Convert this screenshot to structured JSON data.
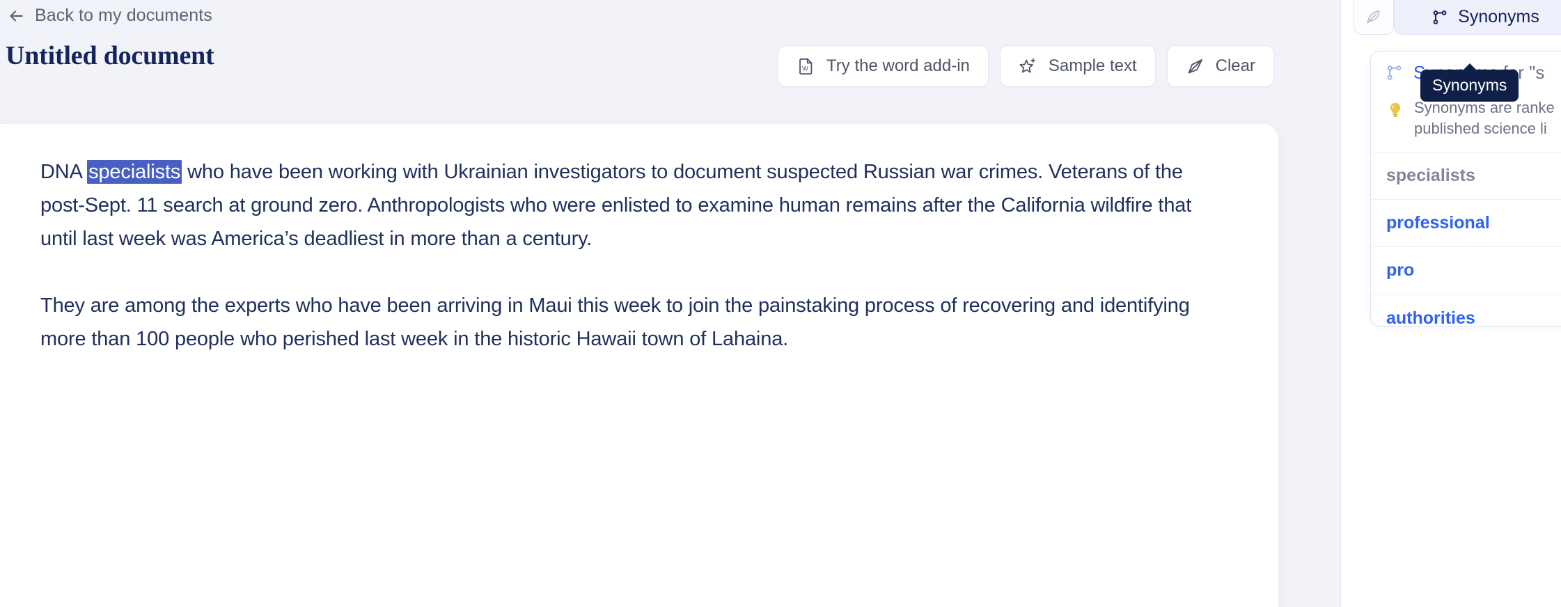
{
  "header": {
    "back_label": "Back to my documents",
    "back_icon": "arrow-left-icon",
    "document_title": "Untitled document"
  },
  "toolbar": {
    "buttons": [
      {
        "label": "Try the word add-in",
        "icon": "word-document-icon"
      },
      {
        "label": "Sample text",
        "icon": "sparkle-star-icon"
      },
      {
        "label": "Clear",
        "icon": "eraser-icon"
      }
    ]
  },
  "document": {
    "paragraph1": {
      "before": "DNA ",
      "highlight": "specialists",
      "after": " who have been working with Ukrainian investigators to document suspected Russian war crimes. Veterans of the post-Sept. 11 search at ground zero. Anthropologists who were enlisted to examine human remains after the California wildfire that until last week was America’s deadliest in more than a century."
    },
    "paragraph2": "They are among the experts who have been arriving in Maui this week to join the painstaking process of recovering and identifying more than 100 people who perished last week in the historic Hawaii town of Lahaina."
  },
  "right_panel": {
    "tabs": [
      {
        "label": "",
        "icon": "feather-pen-icon",
        "active": false
      },
      {
        "label": "Synonyms",
        "icon": "branch-synonyms-icon",
        "active": true
      }
    ],
    "tooltip": "Synonyms",
    "card": {
      "icon": "branch-synonyms-icon",
      "heading_strong": "Synonyms",
      "heading_muted": " for \"s",
      "tip_icon": "lightbulb-icon",
      "tip_line1": "Synonyms are ranke",
      "tip_line2": "published science li",
      "items": [
        {
          "label": "specialists",
          "state": "current"
        },
        {
          "label": "professional",
          "state": "alt"
        },
        {
          "label": "pro",
          "state": "alt"
        },
        {
          "label": "authorities",
          "state": "alt"
        }
      ]
    }
  },
  "colors": {
    "page_bg": "#f2f3f8",
    "accent_blue": "#2f63ef",
    "highlight_blue": "#4a5fc4",
    "title_navy": "#14245c",
    "body_text": "#20305c",
    "muted_text": "#6b7285",
    "tooltip_bg": "#0f1f47"
  }
}
